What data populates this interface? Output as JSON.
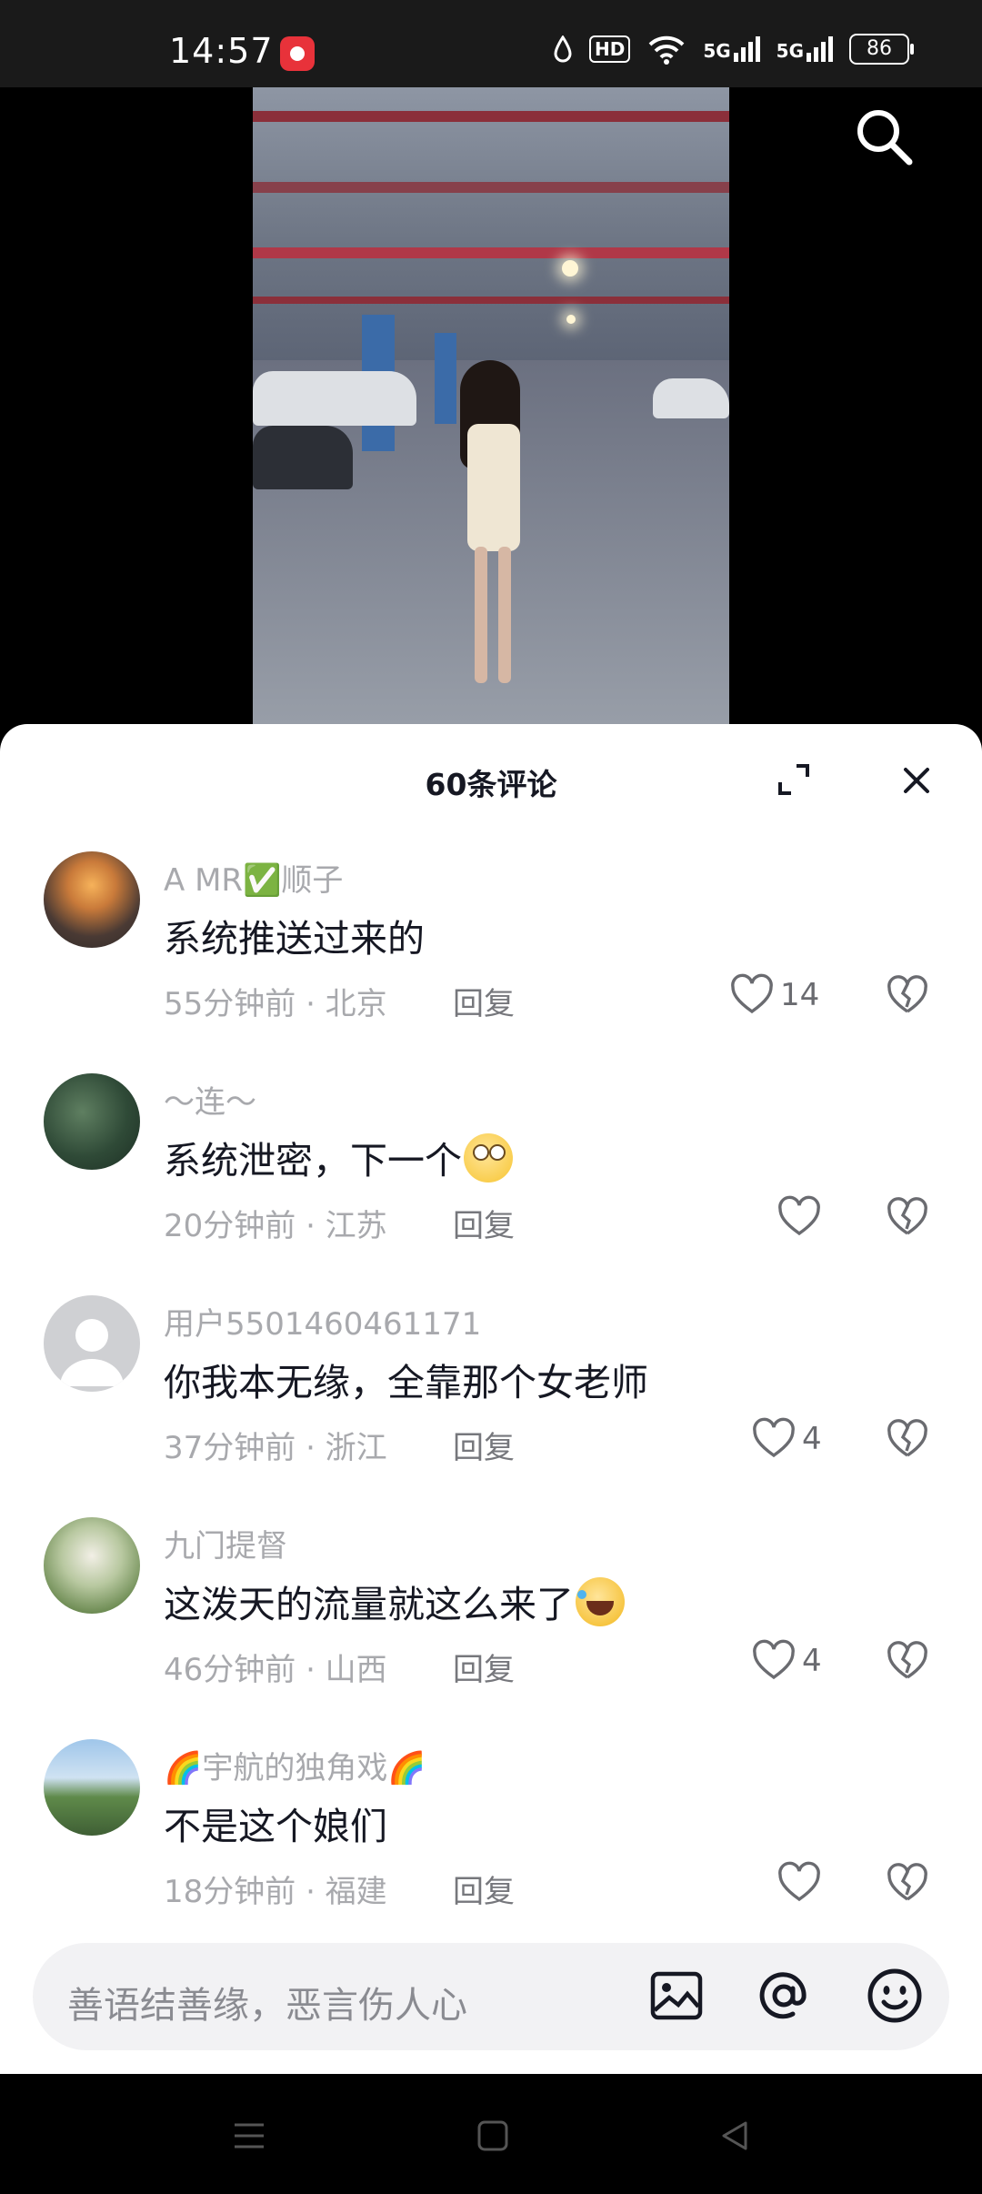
{
  "status_bar": {
    "time": "14:57",
    "hd_label": "HD",
    "network_1": "5G",
    "network_2": "5G",
    "battery": "86"
  },
  "video": {
    "icons": {
      "search": "search-icon"
    }
  },
  "comments_panel": {
    "title": "60条评论",
    "icons": {
      "expand": "expand-icon",
      "close": "close-icon"
    },
    "comments": [
      {
        "name": "A   MR✅顺子",
        "text": "系统推送过来的",
        "emoji": "",
        "time_location": "55分钟前 · 北京",
        "reply": "回复",
        "likes": "14"
      },
      {
        "name": "～连～",
        "text": "系统泄密，下一个",
        "emoji": "rolling-eyes-emoji",
        "time_location": "20分钟前 · 江苏",
        "reply": "回复",
        "likes": ""
      },
      {
        "name": "用户5501460461171",
        "text": "你我本无缘，全靠那个女老师",
        "emoji": "",
        "time_location": "37分钟前 · 浙江",
        "reply": "回复",
        "likes": "4"
      },
      {
        "name": "九门提督",
        "text": "这泼天的流量就这么来了",
        "emoji": "laughing-crying-emoji",
        "time_location": "46分钟前 · 山西",
        "reply": "回复",
        "likes": "4"
      },
      {
        "name": "🌈宇航的独角戏🌈",
        "text": "不是这个娘们",
        "emoji": "",
        "time_location": "18分钟前 · 福建",
        "reply": "回复",
        "likes": ""
      }
    ]
  },
  "input_bar": {
    "placeholder": "善语结善缘，恶言伤人心",
    "icons": [
      "image-icon",
      "at-icon",
      "emoji-icon"
    ]
  },
  "nav_bar": {
    "icons": [
      "menu-icon",
      "home-icon",
      "back-icon"
    ]
  },
  "colors": {
    "text_primary": "#161823",
    "text_secondary": "#a8a9ad",
    "sheet_bg": "#ffffff",
    "input_bg": "#f2f2f4"
  }
}
